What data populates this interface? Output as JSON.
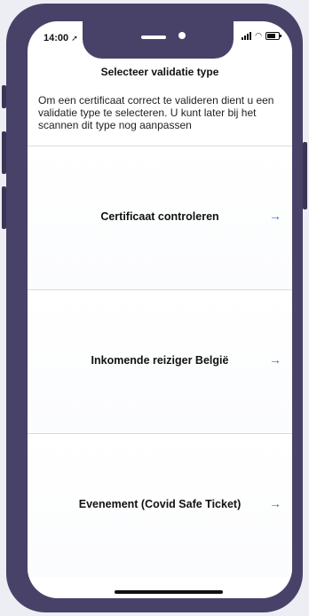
{
  "status_bar": {
    "time": "14:00",
    "location_icon": "location-arrow-icon"
  },
  "header": {
    "title": "Selecteer validatie type"
  },
  "description": "Om een certificaat correct te valideren dient u een validatie type te selecteren. U kunt later bij het scannen dit type nog aanpassen",
  "options": [
    {
      "label": "Certificaat controleren",
      "arrow": "→"
    },
    {
      "label": "Inkomende reiziger België",
      "arrow": "→"
    },
    {
      "label": "Evenement (Covid Safe Ticket)",
      "arrow": "→"
    }
  ],
  "colors": {
    "accent": "#3b6de0",
    "frame": "#484268"
  }
}
